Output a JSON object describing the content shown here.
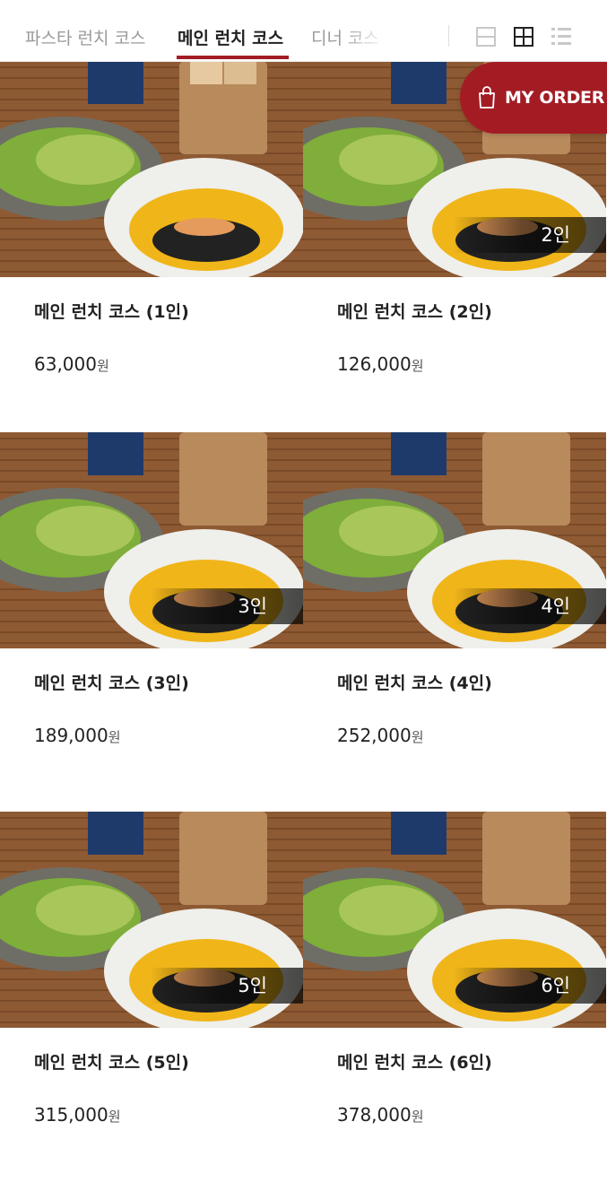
{
  "tabs": [
    {
      "label": "파스타 런치 코스",
      "active": false
    },
    {
      "label": "메인 런치 코스",
      "active": true
    },
    {
      "label": "디너 코스",
      "active": false
    }
  ],
  "view_modes": [
    "single-column",
    "grid",
    "list"
  ],
  "accent_color": "#a31c24",
  "my_order": {
    "label": "MY ORDER",
    "icon": "shopping-bag-icon"
  },
  "products": [
    {
      "name": "메인 런치 코스 (1인)",
      "price": "63,000",
      "currency": "원",
      "badge": ""
    },
    {
      "name": "메인 런치 코스 (2인)",
      "price": "126,000",
      "currency": "원",
      "badge": "2인"
    },
    {
      "name": "메인 런치 코스 (3인)",
      "price": "189,000",
      "currency": "원",
      "badge": "3인"
    },
    {
      "name": "메인 런치 코스 (4인)",
      "price": "252,000",
      "currency": "원",
      "badge": "4인"
    },
    {
      "name": "메인 런치 코스 (5인)",
      "price": "315,000",
      "currency": "원",
      "badge": "5인"
    },
    {
      "name": "메인 런치 코스 (6인)",
      "price": "378,000",
      "currency": "원",
      "badge": "6인"
    }
  ]
}
